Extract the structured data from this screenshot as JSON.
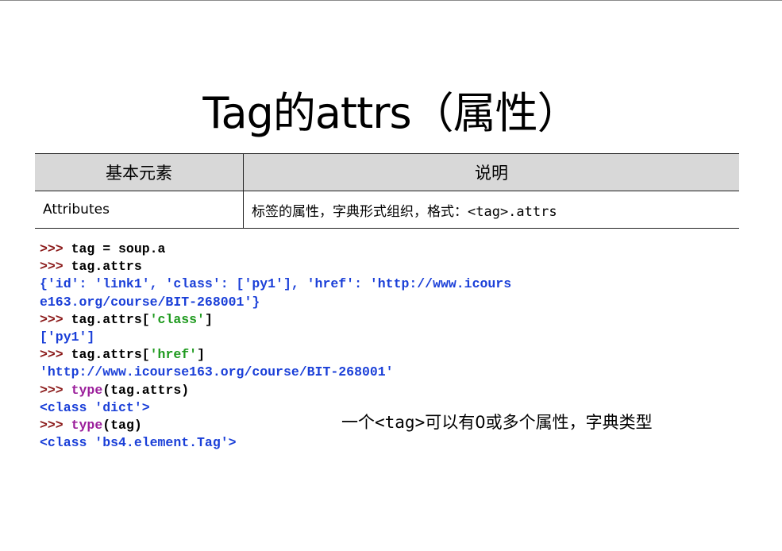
{
  "slide": {
    "title": "Tag的attrs（属性）",
    "table": {
      "headers": [
        "基本元素",
        "说明"
      ],
      "rows": [
        {
          "element": "Attributes",
          "desc_prefix": "标签的属性，字典形式组织，格式：",
          "desc_code": "<tag>.attrs"
        }
      ]
    },
    "code_lines": [
      {
        "prompt": ">>>",
        "code": " tag = soup.a"
      },
      {
        "prompt": ">>>",
        "code": " tag.attrs"
      },
      {
        "output": "{'id': 'link1', 'class': ['py1'], 'href': 'http://www.icours"
      },
      {
        "output": "e163.org/course/BIT-268001'}"
      },
      {
        "prompt": ">>>",
        "code_a": " tag.attrs[",
        "str": "'class'",
        "code_b": "]"
      },
      {
        "output": "['py1']"
      },
      {
        "prompt": ">>>",
        "code_a": " tag.attrs[",
        "str": "'href'",
        "code_b": "]"
      },
      {
        "output": "'http://www.icourse163.org/course/BIT-268001'"
      },
      {
        "prompt": ">>>",
        "kw": " type",
        "code": "(tag.attrs)"
      },
      {
        "output": "<class 'dict'>"
      },
      {
        "prompt": ">>>",
        "kw": " type",
        "code": "(tag)"
      },
      {
        "output": "<class 'bs4.element.Tag'>"
      }
    ],
    "note_prefix": "一个",
    "note_code": "<tag>",
    "note_suffix": "可以有0或多个属性，字典类型",
    "colors": {
      "prompt": "#8b1a1a",
      "output": "#1a3fd8",
      "string": "#1e9a1e",
      "keyword": "#9b1e9b",
      "header_bg": "#d8d8d8"
    }
  }
}
